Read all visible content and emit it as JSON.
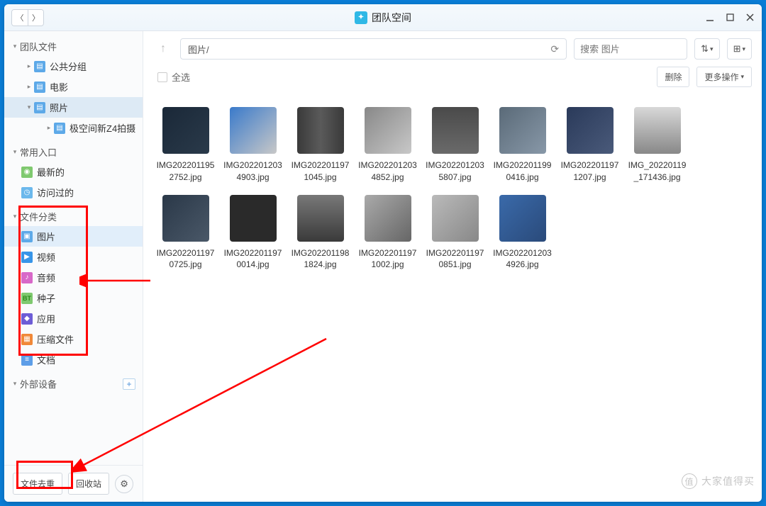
{
  "window": {
    "title": "团队空间"
  },
  "sidebar": {
    "sections": {
      "team_files": {
        "label": "团队文件",
        "items": [
          {
            "label": "公共分组"
          },
          {
            "label": "电影"
          },
          {
            "label": "照片",
            "children": [
              {
                "label": "极空间新Z4拍摄"
              }
            ]
          }
        ]
      },
      "frequent": {
        "label": "常用入口",
        "items": [
          {
            "label": "最新的"
          },
          {
            "label": "访问过的"
          }
        ]
      },
      "categories": {
        "label": "文件分类",
        "items": [
          {
            "label": "图片"
          },
          {
            "label": "视频"
          },
          {
            "label": "音频"
          },
          {
            "label": "种子"
          },
          {
            "label": "应用"
          },
          {
            "label": "压缩文件"
          },
          {
            "label": "文档"
          }
        ]
      },
      "external": {
        "label": "外部设备"
      }
    },
    "footer": {
      "dedup": "文件去重",
      "recycle": "回收站"
    }
  },
  "toolbar": {
    "path": "图片/",
    "search_placeholder": "搜索 图片"
  },
  "subbar": {
    "select_all": "全选",
    "delete": "删除",
    "more": "更多操作"
  },
  "files": [
    {
      "name": "IMG2022011952752.jpg"
    },
    {
      "name": "IMG2022012034903.jpg"
    },
    {
      "name": "IMG2022011971045.jpg"
    },
    {
      "name": "IMG2022012034852.jpg"
    },
    {
      "name": "IMG2022012035807.jpg"
    },
    {
      "name": "IMG2022011990416.jpg"
    },
    {
      "name": "IMG2022011971207.jpg"
    },
    {
      "name": "IMG_20220119_171436.jpg"
    },
    {
      "name": "IMG2022011970725.jpg"
    },
    {
      "name": "IMG2022011970014.jpg"
    },
    {
      "name": "IMG2022011981824.jpg"
    },
    {
      "name": "IMG2022011971002.jpg"
    },
    {
      "name": "IMG2022011970851.jpg"
    },
    {
      "name": "IMG2022012034926.jpg"
    }
  ],
  "watermark": "大家值得买"
}
